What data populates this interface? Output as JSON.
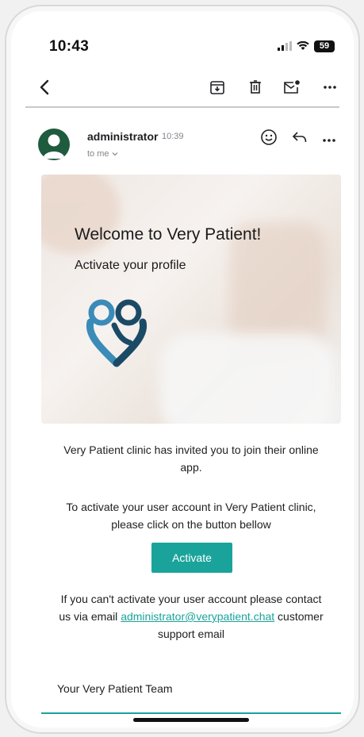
{
  "status_bar": {
    "time": "10:43",
    "battery": "59"
  },
  "toolbar": {
    "back_icon": "chevron-left-icon",
    "archive_icon": "archive-icon",
    "delete_icon": "trash-icon",
    "unread_icon": "mail-unread-icon",
    "more_icon": "more-horizontal-icon"
  },
  "message": {
    "sender": "administrator",
    "time": "10:39",
    "recipient": "to me"
  },
  "hero": {
    "title": "Welcome to Very Patient!",
    "subtitle": "Activate your profile"
  },
  "body": {
    "invite_text": "Very Patient clinic has invited you to join their online app.",
    "instruction_text": "To activate your user account in Very Patient clinic, please click on the button bellow",
    "activate_label": "Activate",
    "fallback_prefix": "If you can't activate your user account please contact us via email",
    "support_email": "administrator@verypatient.chat",
    "fallback_suffix": "customer support email",
    "signature": "Your Very Patient Team"
  },
  "colors": {
    "accent": "#1aa39a",
    "avatar": "#1f5b3e",
    "logo_dark": "#1b4a66",
    "logo_light": "#3a8bb8"
  }
}
